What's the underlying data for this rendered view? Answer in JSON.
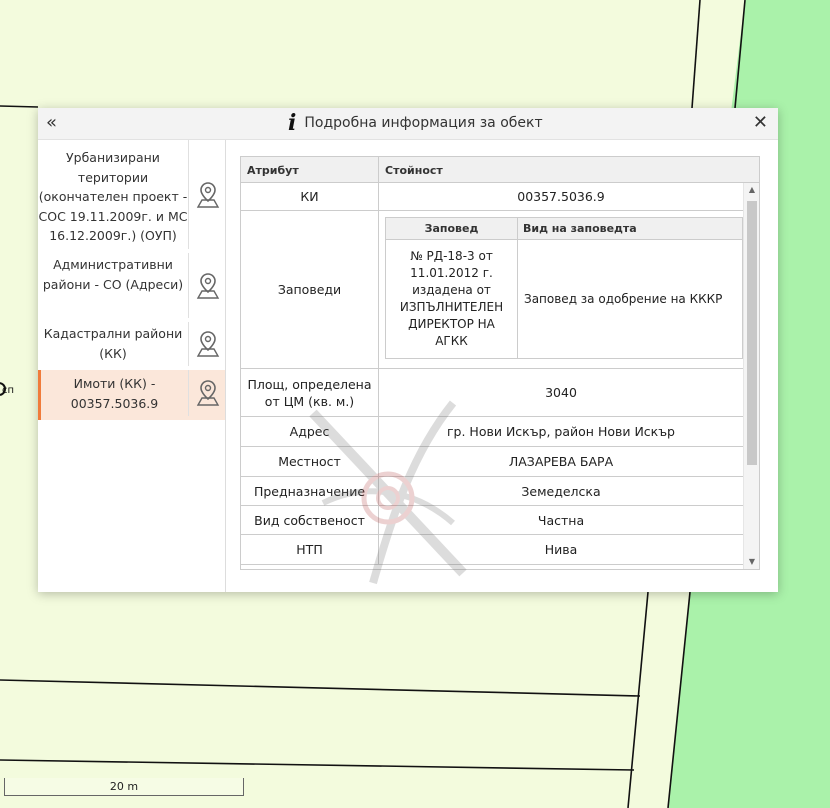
{
  "map": {
    "marker_label": "сп",
    "scale_label": "20 m"
  },
  "dialog": {
    "collapse_symbol": "«",
    "info_symbol": "i",
    "title": "Подробна информация за обект",
    "close_symbol": "✕"
  },
  "sidebar": {
    "items": [
      {
        "label": "Урбанизирани територии (окончателен проект - СОС 19.11.2009г. и МС 16.12.2009г.) (ОУП)",
        "active": false
      },
      {
        "label": "Административни райони - СО (Адреси)",
        "active": false
      },
      {
        "label": "Кадастрални райони (КК)",
        "active": false
      },
      {
        "label": "Имоти (КК) - 00357.5036.9",
        "active": true
      }
    ]
  },
  "table": {
    "headers": [
      "Атрибут",
      "Стойност"
    ],
    "rows": [
      {
        "attr": "КИ",
        "value": "00357.5036.9"
      },
      {
        "attr": "Заповеди"
      },
      {
        "attr": "Площ, определена от ЦМ (кв. м.)",
        "value": "3040"
      },
      {
        "attr": "Адрес",
        "value": "гр. Нови Искър, район Нови Искър"
      },
      {
        "attr": "Местност",
        "value": "ЛАЗАРЕВА БАРА"
      },
      {
        "attr": "Предназначение",
        "value": "Земеделска"
      },
      {
        "attr": "Вид собственост",
        "value": "Частна"
      },
      {
        "attr": "НТП",
        "value": "Нива"
      }
    ],
    "orders": {
      "headers": [
        "Заповед",
        "Вид на заповедта"
      ],
      "rows": [
        {
          "order": "№ РД-18-3 от 11.01.2012 г. издадена от ИЗПЪЛНИТЕЛЕН ДИРЕКТОР НА АГКК",
          "type": "Заповед за одобрение на КККР"
        }
      ]
    }
  },
  "colors": {
    "map_background": "#f3fbdd",
    "map_green": "#aaf2aa",
    "active_item_bg": "#fbe7da",
    "active_item_border": "#f07b3a"
  }
}
